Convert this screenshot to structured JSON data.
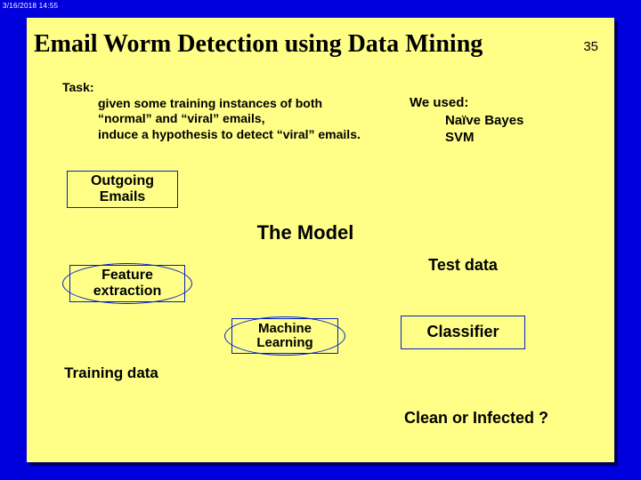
{
  "timestamp": "3/16/2018  14:55",
  "page_number": "35",
  "title": "Email Worm Detection using Data Mining",
  "task": {
    "heading": "Task:",
    "line1": "given some training instances of both",
    "line2": "“normal” and “viral” emails,",
    "line3": "induce a hypothesis to detect “viral” emails."
  },
  "we_used": {
    "heading": "We used:",
    "item1": "Naïve Bayes",
    "item2": "SVM"
  },
  "nodes": {
    "outgoing": "Outgoing\nEmails",
    "model": "The Model",
    "feature": "Feature\nextraction",
    "test_data": "Test data",
    "machine": "Machine\nLearning",
    "classifier": "Classifier",
    "training": "Training data",
    "result": "Clean or Infected ?"
  }
}
